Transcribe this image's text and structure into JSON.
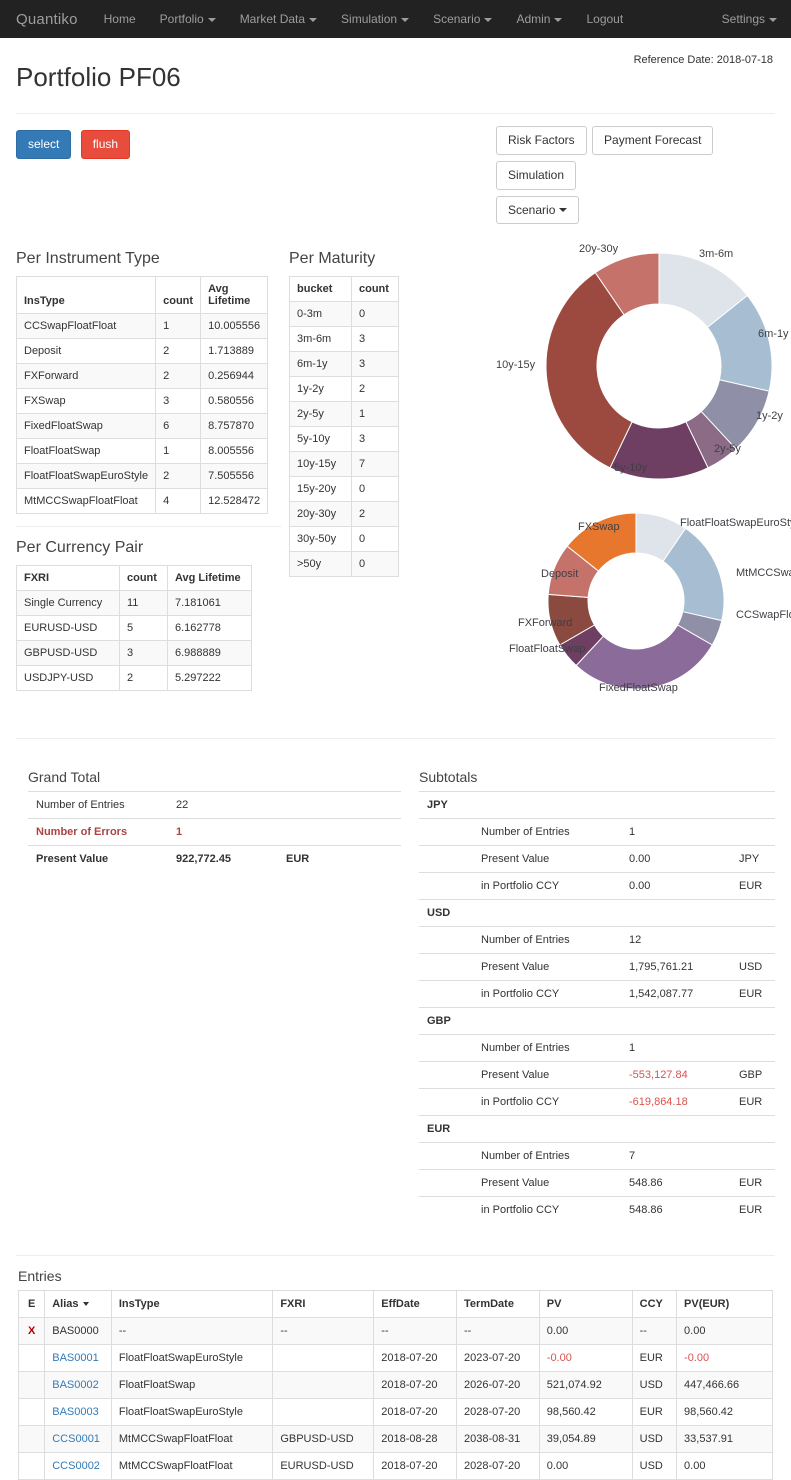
{
  "navbar": {
    "brand": "Quantiko",
    "items": [
      {
        "label": "Home",
        "caret": false
      },
      {
        "label": "Portfolio",
        "caret": true
      },
      {
        "label": "Market Data",
        "caret": true
      },
      {
        "label": "Simulation",
        "caret": true
      },
      {
        "label": "Scenario",
        "caret": true
      },
      {
        "label": "Admin",
        "caret": true
      },
      {
        "label": "Logout",
        "caret": false
      }
    ],
    "settings": "Settings"
  },
  "header": {
    "title": "Portfolio PF06",
    "reference_date": "Reference Date: 2018-07-18"
  },
  "toolbar_left": {
    "select": "select",
    "flush": "flush"
  },
  "toolbar_right": {
    "risk_factors": "Risk Factors",
    "payment_forecast": "Payment Forecast",
    "simulation": "Simulation",
    "scenario": "Scenario"
  },
  "per_instrument_type": {
    "title": "Per Instrument Type",
    "headers": [
      "InsType",
      "count",
      "Avg Lifetime"
    ],
    "rows": [
      [
        "CCSwapFloatFloat",
        "1",
        "10.005556"
      ],
      [
        "Deposit",
        "2",
        "1.713889"
      ],
      [
        "FXForward",
        "2",
        "0.256944"
      ],
      [
        "FXSwap",
        "3",
        "0.580556"
      ],
      [
        "FixedFloatSwap",
        "6",
        "8.757870"
      ],
      [
        "FloatFloatSwap",
        "1",
        "8.005556"
      ],
      [
        "FloatFloatSwapEuroStyle",
        "2",
        "7.505556"
      ],
      [
        "MtMCCSwapFloatFloat",
        "4",
        "12.528472"
      ]
    ]
  },
  "per_maturity": {
    "title": "Per Maturity",
    "headers": [
      "bucket",
      "count"
    ],
    "rows": [
      [
        "0-3m",
        "0"
      ],
      [
        "3m-6m",
        "3"
      ],
      [
        "6m-1y",
        "3"
      ],
      [
        "1y-2y",
        "2"
      ],
      [
        "2y-5y",
        "1"
      ],
      [
        "5y-10y",
        "3"
      ],
      [
        "10y-15y",
        "7"
      ],
      [
        "15y-20y",
        "0"
      ],
      [
        "20y-30y",
        "2"
      ],
      [
        "30y-50y",
        "0"
      ],
      [
        ">50y",
        "0"
      ]
    ]
  },
  "per_currency_pair": {
    "title": "Per Currency Pair",
    "headers": [
      "FXRI",
      "count",
      "Avg Lifetime"
    ],
    "rows": [
      [
        "Single Currency",
        "11",
        "7.181061"
      ],
      [
        "EURUSD-USD",
        "5",
        "6.162778"
      ],
      [
        "GBPUSD-USD",
        "3",
        "6.988889"
      ],
      [
        "USDJPY-USD",
        "2",
        "5.297222"
      ]
    ]
  },
  "chart_data": [
    {
      "type": "pie",
      "name": "maturity-donut",
      "title": "",
      "legend_position": "outside-labels",
      "categories": [
        "3m-6m",
        "6m-1y",
        "1y-2y",
        "2y-5y",
        "5y-10y",
        "10y-15y",
        "20y-30y"
      ],
      "values": [
        3,
        3,
        2,
        1,
        3,
        7,
        2
      ],
      "colors": [
        "#dfe3ea",
        "#a7bed2",
        "#8f8fa8",
        "#8b6b86",
        "#6e3f63",
        "#9c4a40",
        "#c4726a"
      ]
    },
    {
      "type": "pie",
      "name": "instrument-type-donut",
      "title": "",
      "legend_position": "outside-labels",
      "categories": [
        "FloatFloatSwapEuroStyle",
        "MtMCCSwapFloatFloat",
        "CCSwapFloatFloat",
        "FixedFloatSwap",
        "FloatFloatSwap",
        "FXForward",
        "Deposit",
        "FXSwap"
      ],
      "labels_shown": [
        "FloatFloatSwapEuroStyle",
        "MtMCCSwapFlo",
        "CCSwapFloatFlo",
        "FixedFloatSwap",
        "FloatFloatSwap",
        "FXForward",
        "Deposit",
        "FXSwap"
      ],
      "values": [
        2,
        4,
        1,
        6,
        1,
        2,
        2,
        3
      ],
      "colors": [
        "#dfe3ea",
        "#a7bed2",
        "#8f8fa8",
        "#8b6b99",
        "#6e3f63",
        "#8a4a40",
        "#c4726a",
        "#e8772e"
      ]
    }
  ],
  "grand_total": {
    "title": "Grand Total",
    "rows": [
      {
        "label": "Number of Entries",
        "value": "22",
        "ccy": "",
        "style": "normal"
      },
      {
        "label": "Number of Errors",
        "value": "1",
        "ccy": "",
        "style": "error"
      },
      {
        "label": "Present Value",
        "value": "922,772.45",
        "ccy": "EUR",
        "style": "bold"
      }
    ]
  },
  "subtotals": {
    "title": "Subtotals",
    "groups": [
      {
        "ccy": "JPY",
        "rows": [
          {
            "label": "Number of Entries",
            "value": "1",
            "ccy": "",
            "negative": false
          },
          {
            "label": "Present Value",
            "value": "0.00",
            "ccy": "JPY",
            "negative": false
          },
          {
            "label": "in Portfolio CCY",
            "value": "0.00",
            "ccy": "EUR",
            "negative": false
          }
        ]
      },
      {
        "ccy": "USD",
        "rows": [
          {
            "label": "Number of Entries",
            "value": "12",
            "ccy": "",
            "negative": false
          },
          {
            "label": "Present Value",
            "value": "1,795,761.21",
            "ccy": "USD",
            "negative": false
          },
          {
            "label": "in Portfolio CCY",
            "value": "1,542,087.77",
            "ccy": "EUR",
            "negative": false
          }
        ]
      },
      {
        "ccy": "GBP",
        "rows": [
          {
            "label": "Number of Entries",
            "value": "1",
            "ccy": "",
            "negative": false
          },
          {
            "label": "Present Value",
            "value": "-553,127.84",
            "ccy": "GBP",
            "negative": true
          },
          {
            "label": "in Portfolio CCY",
            "value": "-619,864.18",
            "ccy": "EUR",
            "negative": true
          }
        ]
      },
      {
        "ccy": "EUR",
        "rows": [
          {
            "label": "Number of Entries",
            "value": "7",
            "ccy": "",
            "negative": false
          },
          {
            "label": "Present Value",
            "value": "548.86",
            "ccy": "EUR",
            "negative": false
          },
          {
            "label": "in Portfolio CCY",
            "value": "548.86",
            "ccy": "EUR",
            "negative": false
          }
        ]
      }
    ]
  },
  "entries": {
    "title": "Entries",
    "headers": [
      "E",
      "Alias",
      "InsType",
      "FXRI",
      "EffDate",
      "TermDate",
      "PV",
      "CCY",
      "PV(EUR)"
    ],
    "sorted_column": "Alias",
    "rows": [
      {
        "e": "X",
        "alias": "BAS0000",
        "alias_link": false,
        "instype": "--",
        "fxri": "--",
        "eff": "--",
        "term": "--",
        "pv": "0.00",
        "pv_neg": false,
        "ccy": "--",
        "pveur": "0.00",
        "pveur_neg": false
      },
      {
        "e": "",
        "alias": "BAS0001",
        "alias_link": true,
        "instype": "FloatFloatSwapEuroStyle",
        "fxri": "",
        "eff": "2018-07-20",
        "term": "2023-07-20",
        "pv": "-0.00",
        "pv_neg": true,
        "ccy": "EUR",
        "pveur": "-0.00",
        "pveur_neg": true
      },
      {
        "e": "",
        "alias": "BAS0002",
        "alias_link": true,
        "instype": "FloatFloatSwap",
        "fxri": "",
        "eff": "2018-07-20",
        "term": "2026-07-20",
        "pv": "521,074.92",
        "pv_neg": false,
        "ccy": "USD",
        "pveur": "447,466.66",
        "pveur_neg": false
      },
      {
        "e": "",
        "alias": "BAS0003",
        "alias_link": true,
        "instype": "FloatFloatSwapEuroStyle",
        "fxri": "",
        "eff": "2018-07-20",
        "term": "2028-07-20",
        "pv": "98,560.42",
        "pv_neg": false,
        "ccy": "EUR",
        "pveur": "98,560.42",
        "pveur_neg": false
      },
      {
        "e": "",
        "alias": "CCS0001",
        "alias_link": true,
        "instype": "MtMCCSwapFloatFloat",
        "fxri": "GBPUSD-USD",
        "eff": "2018-08-28",
        "term": "2038-08-31",
        "pv": "39,054.89",
        "pv_neg": false,
        "ccy": "USD",
        "pveur": "33,537.91",
        "pveur_neg": false
      },
      {
        "e": "",
        "alias": "CCS0002",
        "alias_link": true,
        "instype": "MtMCCSwapFloatFloat",
        "fxri": "EURUSD-USD",
        "eff": "2018-07-20",
        "term": "2028-07-20",
        "pv": "0.00",
        "pv_neg": false,
        "ccy": "USD",
        "pveur": "0.00",
        "pveur_neg": false
      }
    ]
  }
}
